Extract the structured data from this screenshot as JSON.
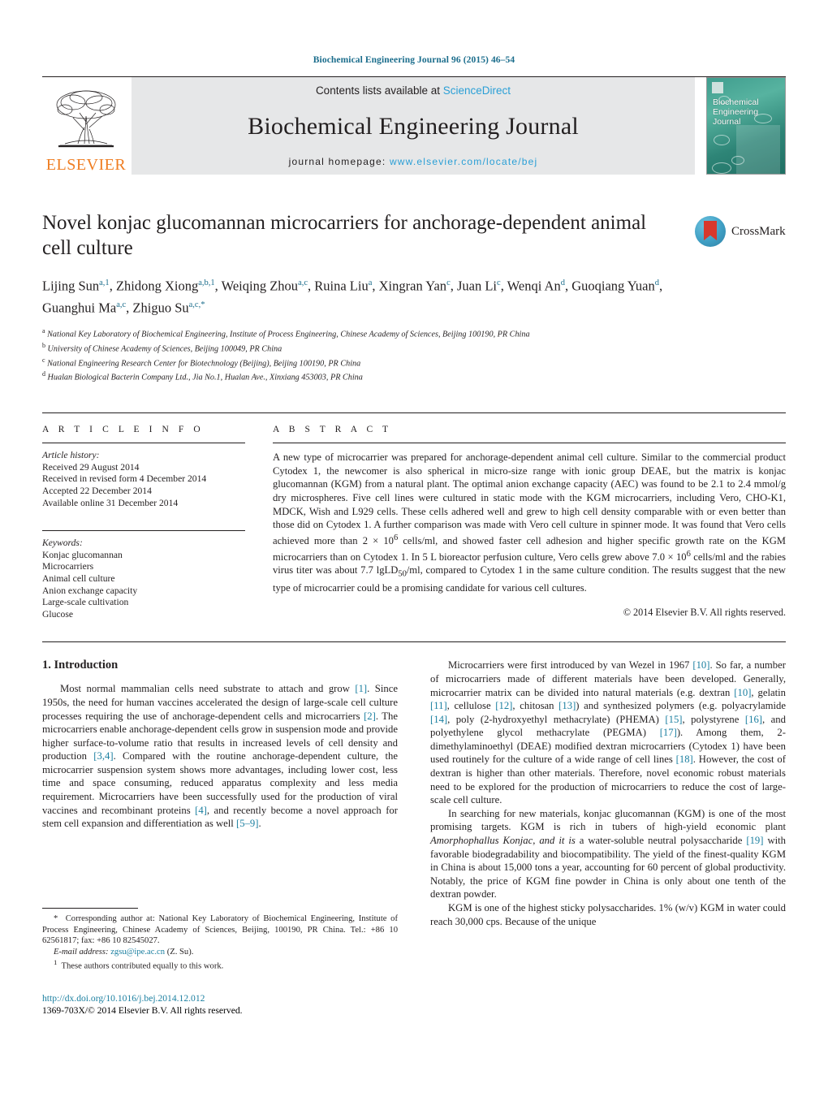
{
  "running_head": "Biochemical Engineering Journal 96 (2015) 46–54",
  "masthead": {
    "publisher_name": "ELSEVIER",
    "contents_prefix": "Contents lists available at ",
    "contents_link": "ScienceDirect",
    "journal_title": "Biochemical Engineering Journal",
    "homepage_label": "journal homepage:",
    "homepage_url": "www.elsevier.com/locate/bej",
    "cover_title_lines": [
      "Biochemical",
      "Engineering",
      "Journal"
    ]
  },
  "article": {
    "title": "Novel konjac glucomannan microcarriers for anchorage-dependent animal cell culture",
    "crossmark_label": "CrossMark",
    "authors_html": "Lijing Sun<sup>a,1</sup>, Zhidong Xiong<sup>a,b,1</sup>, Weiqing Zhou<sup>a,c</sup>, Ruina Liu<sup>a</sup>, Xingran Yan<sup>c</sup>, Juan Li<sup>c</sup>, Wenqi An<sup>d</sup>, Guoqiang Yuan<sup>d</sup>, Guanghui Ma<sup>a,c</sup>, Zhiguo Su<sup>a,c,</sup><sup>*</sup>",
    "affiliations": [
      {
        "marker": "a",
        "text": "National Key Laboratory of Biochemical Engineering, Institute of Process Engineering, Chinese Academy of Sciences, Beijing 100190, PR China"
      },
      {
        "marker": "b",
        "text": "University of Chinese Academy of Sciences, Beijing 100049, PR China"
      },
      {
        "marker": "c",
        "text": "National Engineering Research Center for Biotechnology (Beijing), Beijing 100190, PR China"
      },
      {
        "marker": "d",
        "text": "Hualan Biological Bacterin Company Ltd., Jia No.1, Hualan Ave., Xinxiang 453003, PR China"
      }
    ]
  },
  "article_info": {
    "heading": "A R T I C L E   I N F O",
    "history_label": "Article history:",
    "history": [
      "Received 29 August 2014",
      "Received in revised form 4 December 2014",
      "Accepted 22 December 2014",
      "Available online 31 December 2014"
    ],
    "keywords_label": "Keywords:",
    "keywords": [
      "Konjac glucomannan",
      "Microcarriers",
      "Animal cell culture",
      "Anion exchange capacity",
      "Large-scale cultivation",
      "Glucose"
    ]
  },
  "abstract": {
    "heading": "A B S T R A C T",
    "text_html": "A new type of microcarrier was prepared for anchorage-dependent animal cell culture. Similar to the commercial product Cytodex 1, the newcomer is also spherical in micro-size range with ionic group DEAE, but the matrix is konjac glucomannan (KGM) from a natural plant. The optimal anion exchange capacity (AEC) was found to be 2.1 to 2.4 mmol/g dry microspheres. Five cell lines were cultured in static mode with the KGM microcarriers, including Vero, CHO-K1, MDCK, Wish and L929 cells. These cells adhered well and grew to high cell density comparable with or even better than those did on Cytodex 1. A further comparison was made with Vero cell culture in spinner mode. It was found that Vero cells achieved more than 2 &times; 10<sup>6</sup> cells/ml, and showed faster cell adhesion and higher specific growth rate on the KGM microcarriers than on Cytodex 1. In 5 L bioreactor perfusion culture, Vero cells grew above 7.0 &times; 10<sup>6</sup> cells/ml and the rabies virus titer was about 7.7 lgLD<sub>50</sub>/ml, compared to Cytodex 1 in the same culture condition. The results suggest that the new type of microcarrier could be a promising candidate for various cell cultures.",
    "copyright": "© 2014 Elsevier B.V. All rights reserved."
  },
  "body": {
    "section_number_title": "1.  Introduction",
    "left_paragraphs_html": [
      "Most normal mammalian cells need substrate to attach and grow <span class=\"ref\">[1]</span>. Since 1950s, the need for human vaccines accelerated the design of large-scale cell culture processes requiring the use of anchorage-dependent cells and microcarriers <span class=\"ref\">[2]</span>. The microcarriers enable anchorage-dependent cells grow in suspension mode and provide higher surface-to-volume ratio that results in increased levels of cell density and production <span class=\"ref\">[3,4]</span>. Compared with the routine anchorage-dependent culture, the microcarrier suspension system shows more advantages, including lower cost, less time and space consuming, reduced apparatus complexity and less media requirement. Microcarriers have been successfully used for the production of viral vaccines and recombinant proteins <span class=\"ref\">[4]</span>, and recently become a novel approach for stem cell expansion and differentiation as well <span class=\"ref\">[5–9]</span>."
    ],
    "right_paragraphs_html": [
      "Microcarriers were first introduced by van Wezel in 1967 <span class=\"ref\">[10]</span>. So far, a number of microcarriers made of different materials have been developed. Generally, microcarrier matrix can be divided into natural materials (e.g. dextran <span class=\"ref\">[10]</span>, gelatin <span class=\"ref\">[11]</span>, cellulose <span class=\"ref\">[12]</span>, chitosan <span class=\"ref\">[13]</span>) and synthesized polymers (e.g. polyacrylamide <span class=\"ref\">[14]</span>, poly (2-hydroxyethyl methacrylate) (PHEMA) <span class=\"ref\">[15]</span>, polystyrene <span class=\"ref\">[16]</span>, and polyethylene glycol methacrylate (PEGMA) <span class=\"ref\">[17]</span>). Among them, 2-dimethylaminoethyl (DEAE) modified dextran microcarriers (Cytodex 1) have been used routinely for the culture of a wide range of cell lines <span class=\"ref\">[18]</span>. However, the cost of dextran is higher than other materials. Therefore, novel economic robust materials need to be explored for the production of microcarriers to reduce the cost of large-scale cell culture.",
      "In searching for new materials, konjac glucomannan (KGM) is one of the most promising targets. KGM is rich in tubers of high-yield economic plant <span class=\"italic\">Amorphophallus Konjac, and it is</span> a water-soluble neutral polysaccharide <span class=\"ref\">[19]</span> with favorable biodegradability and biocompatibility. The yield of the finest-quality KGM in China is about 15,000 tons a year, accounting for 60 percent of global productivity. Notably, the price of KGM fine powder in China is only about one tenth of the dextran powder.",
      "KGM is one of the highest sticky polysaccharides. 1% (w/v) KGM in water could reach 30,000 cps. Because of the unique"
    ]
  },
  "footnotes": {
    "corresponding_html": "<span class=\"star\">*</span>&nbsp; Corresponding author at: National Key Laboratory of Biochemical Engineering, Institute of Process Engineering, Chinese Academy of Sciences, Beijing, 100190, PR China. Tel.: +86 10 62561817; fax: +86 10 82545027.",
    "email_label": "E-mail address:",
    "email": "zgsu@ipe.ac.cn",
    "email_suffix": "(Z. Su).",
    "equal_contribution_html": "<sup>1</sup>&nbsp; These authors contributed equally to this work."
  },
  "doi_block": {
    "doi": "http://dx.doi.org/10.1016/j.bej.2014.12.012",
    "issn_line": "1369-703X/© 2014 Elsevier B.V. All rights reserved."
  },
  "colors": {
    "link": "#1b7fa0",
    "sciencedirect": "#2a9fd6",
    "elsevier_orange": "#ef7d22",
    "masthead_bg": "#e6e7e8"
  }
}
